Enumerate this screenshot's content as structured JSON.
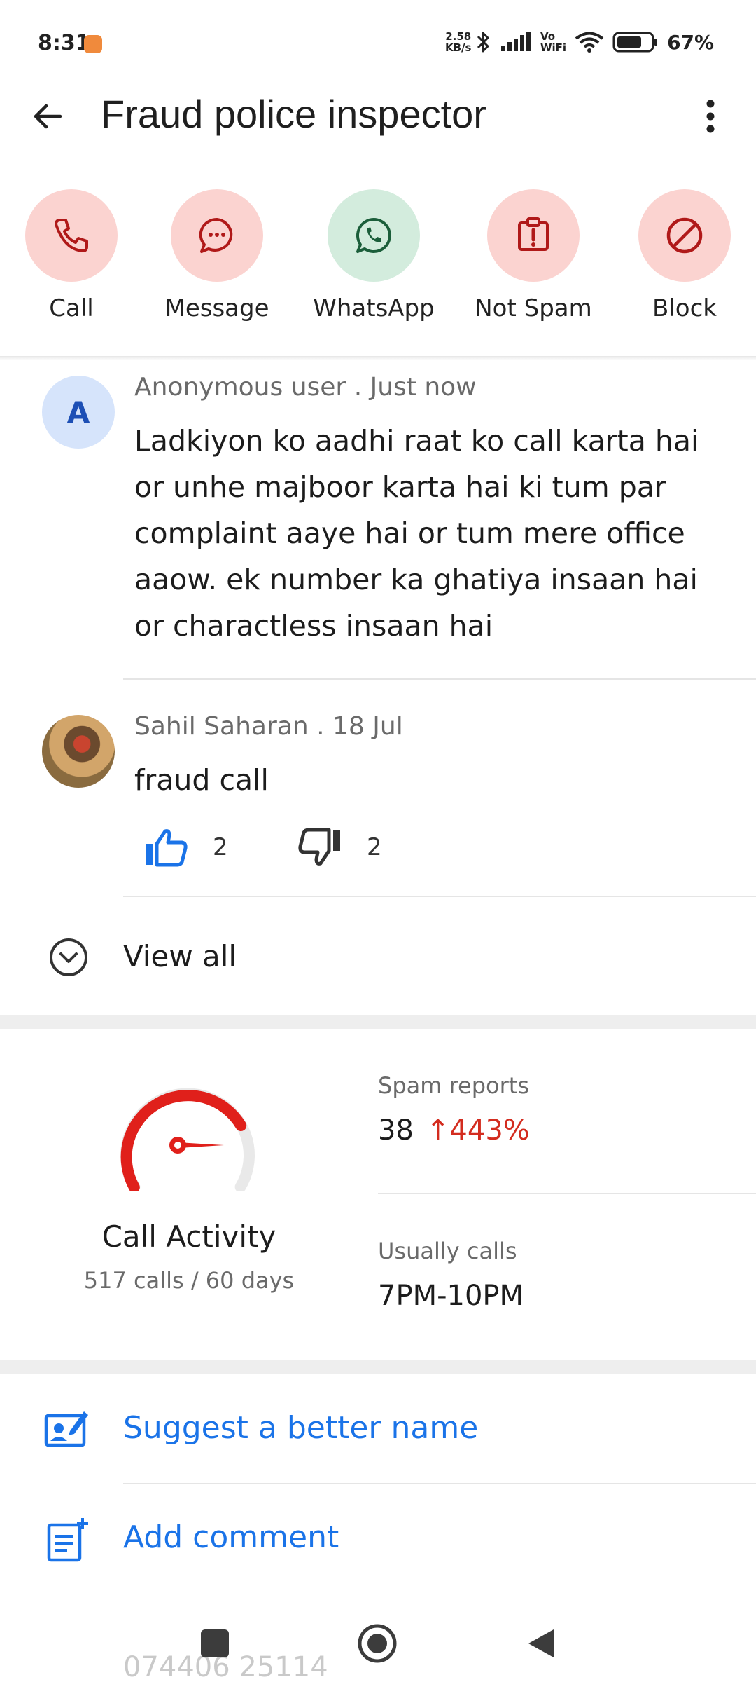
{
  "status_bar": {
    "time": "8:31",
    "net_speed_value": "2.58",
    "net_speed_unit": "KB/s",
    "volte_label": "Vo\nWiFi",
    "battery": "67%"
  },
  "header": {
    "title": "Fraud police inspector"
  },
  "actions": [
    {
      "label": "Call",
      "icon": "phone-icon"
    },
    {
      "label": "Message",
      "icon": "chat-bubble-icon"
    },
    {
      "label": "WhatsApp",
      "icon": "whatsapp-icon"
    },
    {
      "label": "Not Spam",
      "icon": "report-icon"
    },
    {
      "label": "Block",
      "icon": "block-icon"
    }
  ],
  "comments": [
    {
      "avatar_letter": "A",
      "author": "Anonymous user",
      "time": "Just now",
      "text": "Ladkiyon ko aadhi raat ko call karta hai or unhe majboor karta hai ki tum par complaint aaye hai or tum mere office aaow. ek number ka ghatiya insaan hai or charactless insaan hai"
    },
    {
      "author": "Sahil Saharan",
      "time": "18 Jul",
      "text": "fraud call",
      "likes": "2",
      "dislikes": "2"
    }
  ],
  "meta_separator": ".",
  "view_all_label": "View all",
  "stats": {
    "gauge_level": 0.75,
    "call_activity_title": "Call Activity",
    "call_activity_sub": "517 calls / 60 days",
    "spam_reports_label": "Spam reports",
    "spam_reports_value": "38",
    "spam_reports_delta": "↑443%",
    "usually_calls_label": "Usually calls",
    "usually_calls_value": "7PM-10PM"
  },
  "links": {
    "suggest_name": "Suggest a better name",
    "add_comment": "Add comment"
  },
  "peek_number": "074406 25114",
  "colors": {
    "accent_blue": "#1a73e8",
    "danger_red": "#d32c1f",
    "action_red_bg": "#fbd3d0",
    "action_green_bg": "#d3ecdd"
  }
}
